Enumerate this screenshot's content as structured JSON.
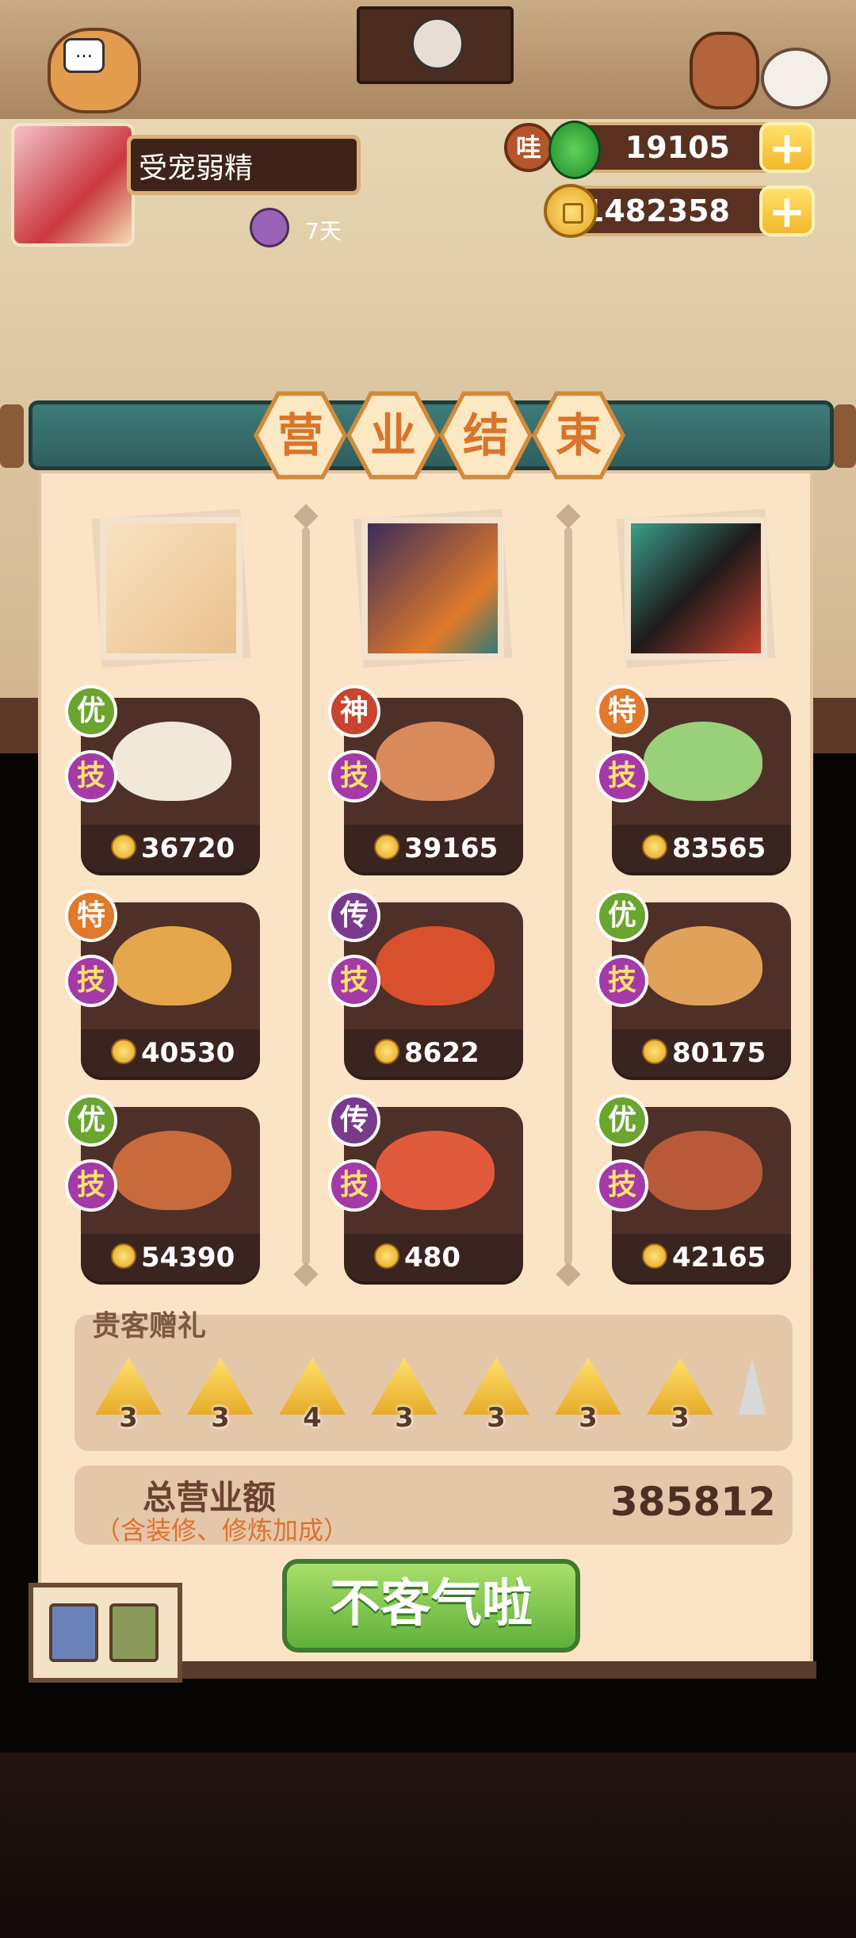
{
  "player": {
    "name": "受宠弱精",
    "days": "7天"
  },
  "currency": {
    "jade_badge": "哇",
    "jade": "19105",
    "coins": "1482358",
    "plus_icon": "+"
  },
  "title_chars": [
    "营",
    "业",
    "结",
    "束"
  ],
  "columns": [
    {
      "dishes": [
        {
          "grade": "优",
          "grade_color": "#6aa52f",
          "skill": "技",
          "price": "36720",
          "food_color": "#f2e8d8"
        },
        {
          "grade": "特",
          "grade_color": "#e07a2a",
          "skill": "技",
          "price": "40530",
          "food_color": "#e4a64a"
        },
        {
          "grade": "优",
          "grade_color": "#6aa52f",
          "skill": "技",
          "price": "54390",
          "food_color": "#c86a3a"
        }
      ]
    },
    {
      "dishes": [
        {
          "grade": "神",
          "grade_color": "#c8442e",
          "skill": "技",
          "price": "39165",
          "food_color": "#d98a5a"
        },
        {
          "grade": "传",
          "grade_color": "#7a3a8c",
          "skill": "技",
          "price": "8622",
          "food_color": "#d8512c"
        },
        {
          "grade": "传",
          "grade_color": "#7a3a8c",
          "skill": "技",
          "price": "480",
          "food_color": "#e25a3c"
        }
      ]
    },
    {
      "dishes": [
        {
          "grade": "特",
          "grade_color": "#e07a2a",
          "skill": "技",
          "price": "83565",
          "food_color": "#9bd07a"
        },
        {
          "grade": "优",
          "grade_color": "#6aa52f",
          "skill": "技",
          "price": "80175",
          "food_color": "#e0a25a"
        },
        {
          "grade": "优",
          "grade_color": "#6aa52f",
          "skill": "技",
          "price": "42165",
          "food_color": "#b85a3a"
        }
      ]
    }
  ],
  "gifts": {
    "label": "贵客赠礼",
    "counts": [
      "3",
      "3",
      "4",
      "3",
      "3",
      "3",
      "3"
    ]
  },
  "total": {
    "label": "总营业额",
    "sub": "（含装修、修炼加成）",
    "value": "385812"
  },
  "button": {
    "label": "不客气啦"
  },
  "colors": {
    "accent_green": "#5fb13a",
    "panel": "#fbe3c6",
    "card": "#4e3028",
    "skill_badge": "#a43aa8"
  }
}
